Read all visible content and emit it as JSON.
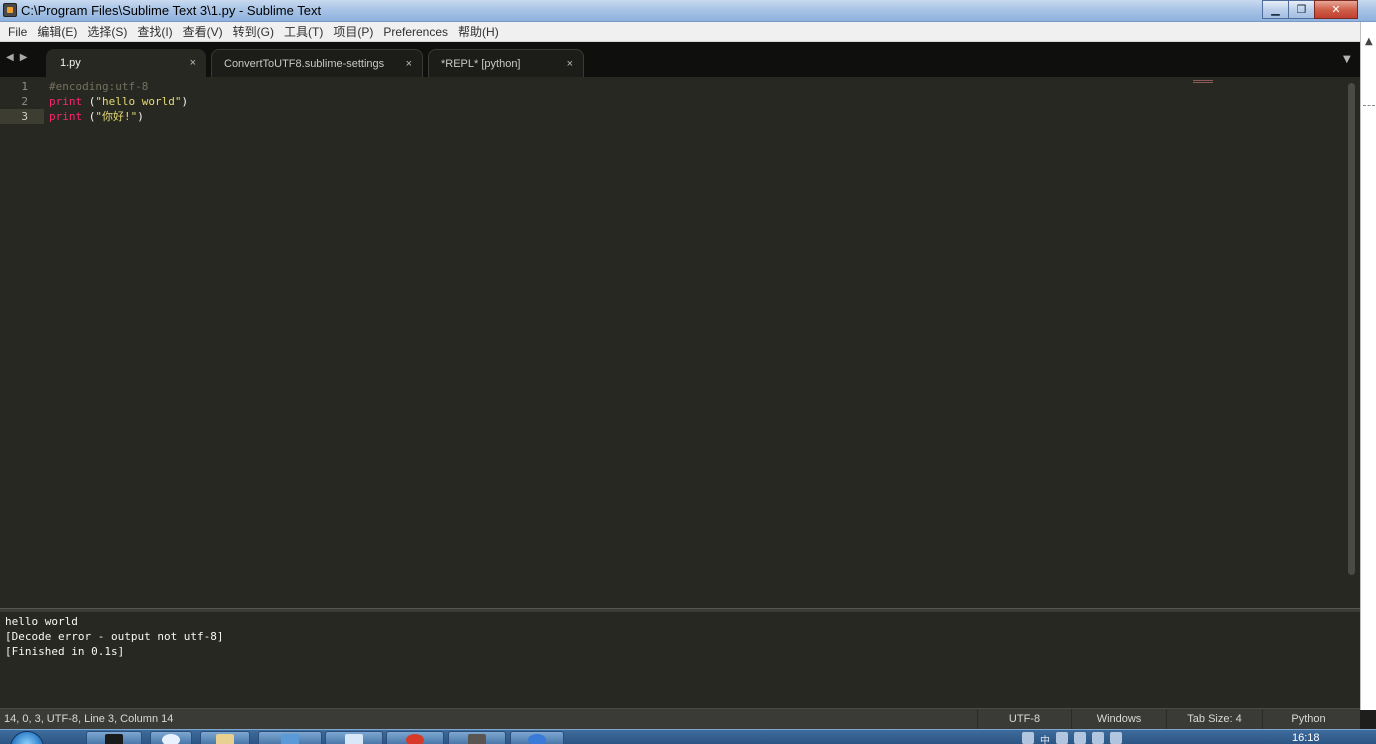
{
  "window": {
    "title": "C:\\Program Files\\Sublime Text 3\\1.py - Sublime Text",
    "buttons": {
      "minimize": "▁",
      "restore": "❐",
      "close": "✕"
    }
  },
  "menu": [
    "File",
    "编辑(E)",
    "选择(S)",
    "查找(I)",
    "查看(V)",
    "转到(G)",
    "工具(T)",
    "项目(P)",
    "Preferences",
    "帮助(H)"
  ],
  "tabs": [
    {
      "label": "1.py",
      "active": true,
      "close": "×"
    },
    {
      "label": "ConvertToUTF8.sublime-settings",
      "active": false,
      "close": "×"
    },
    {
      "label": "*REPL* [python]",
      "active": false,
      "close": "×"
    }
  ],
  "editor": {
    "line_numbers": [
      "1",
      "2",
      "3"
    ],
    "current_line": 3,
    "lines": [
      {
        "comment": "#encoding:utf-8"
      },
      {
        "keyword": "print",
        "open": " (",
        "string": "\"hello world\"",
        "close": ")"
      },
      {
        "keyword": "print",
        "open": " (",
        "string": "\"你好!\"",
        "close": ")"
      }
    ]
  },
  "output": [
    "hello world",
    "[Decode error - output not utf-8]",
    "[Finished in 0.1s]"
  ],
  "status": {
    "left": "14, 0, 3, UTF-8, Line 3, Column 14",
    "encoding": "UTF-8",
    "line_endings": "Windows",
    "tab_size": "Tab Size: 4",
    "syntax": "Python"
  },
  "taskbar": {
    "ime": "中",
    "clock": "16:18"
  },
  "colors": {
    "editor_bg": "#272822",
    "keyword": "#f92672",
    "string": "#e6db74",
    "comment": "#75715e"
  }
}
